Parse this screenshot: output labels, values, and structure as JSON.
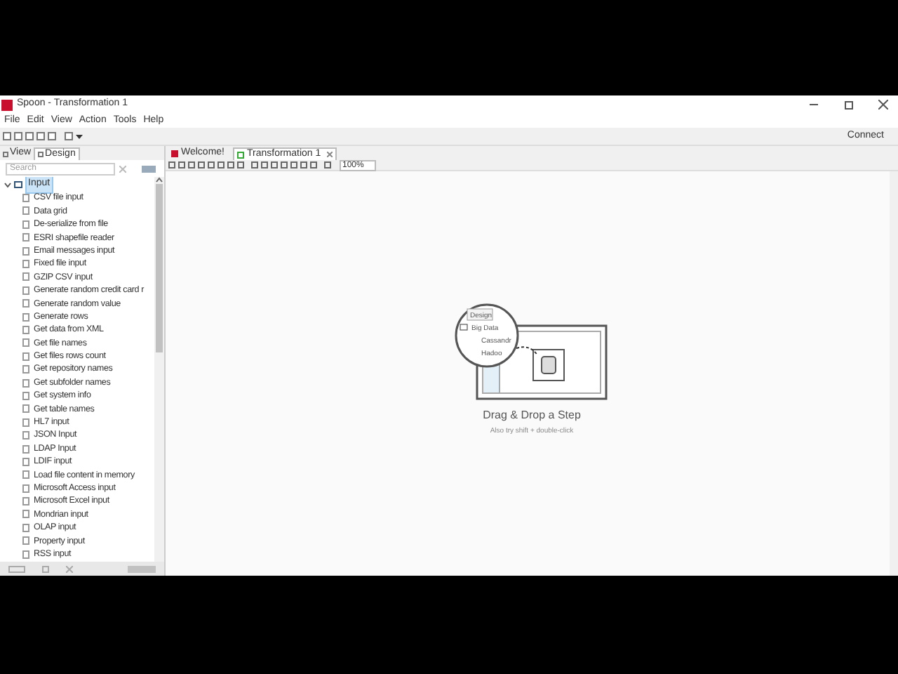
{
  "window": {
    "title": "Spoon - Transformation 1"
  },
  "menu": [
    "File",
    "Edit",
    "View",
    "Action",
    "Tools",
    "Help"
  ],
  "connect": "Connect",
  "left_tabs": [
    {
      "label": "View",
      "selected": false
    },
    {
      "label": "Design",
      "selected": true
    }
  ],
  "search": {
    "placeholder": "Search"
  },
  "tree": {
    "label": "Input",
    "expanded": true,
    "selected": true,
    "children": [
      {
        "label": "CSV file input"
      },
      {
        "label": "Data grid"
      },
      {
        "label": "De-serialize from file"
      },
      {
        "label": "ESRI shapefile reader"
      },
      {
        "label": "Email messages input"
      },
      {
        "label": "Fixed file input"
      },
      {
        "label": "GZIP CSV input"
      },
      {
        "label": "Generate random credit card r"
      },
      {
        "label": "Generate random value"
      },
      {
        "label": "Generate rows"
      },
      {
        "label": "Get data from XML"
      },
      {
        "label": "Get file names"
      },
      {
        "label": "Get files rows count"
      },
      {
        "label": "Get repository names"
      },
      {
        "label": "Get subfolder names"
      },
      {
        "label": "Get system info"
      },
      {
        "label": "Get table names"
      },
      {
        "label": "HL7 input"
      },
      {
        "label": "JSON Input"
      },
      {
        "label": "LDAP Input"
      },
      {
        "label": "LDIF input"
      },
      {
        "label": "Load file content in memory"
      },
      {
        "label": "Microsoft Access input"
      },
      {
        "label": "Microsoft Excel input"
      },
      {
        "label": "Mondrian input"
      },
      {
        "label": "OLAP input"
      },
      {
        "label": "Property input"
      },
      {
        "label": "RSS input"
      }
    ]
  },
  "editor_tabs": [
    {
      "label": "Welcome!",
      "selected": false,
      "closable": false
    },
    {
      "label": "Transformation 1",
      "selected": true,
      "closable": true
    }
  ],
  "zoom": "100%",
  "illustration": {
    "panel_tab": "Design",
    "folder": "Big Data",
    "items": [
      "Cassandr",
      "Hadoo"
    ]
  },
  "hint": {
    "title": "Drag & Drop a Step",
    "subtitle": "Also try shift + double-click"
  }
}
